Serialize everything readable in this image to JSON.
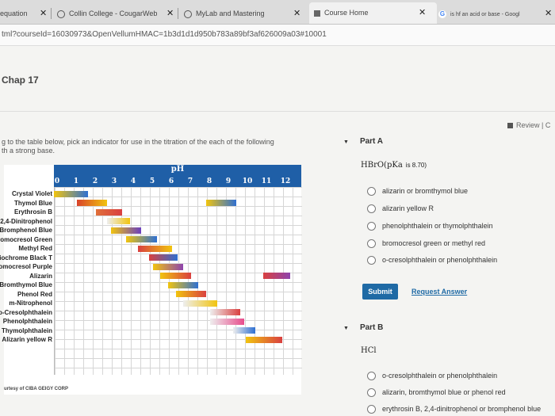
{
  "browser": {
    "tabs": [
      {
        "label": "equation",
        "active": false
      },
      {
        "label": "Collin College - CougarWeb",
        "active": false
      },
      {
        "label": "MyLab and Mastering",
        "active": false
      },
      {
        "label": "Course Home",
        "active": true
      },
      {
        "label": "is hf an acid or base - Googl",
        "active": false
      }
    ],
    "url": "tml?courseId=16030973&OpenVellumHMAC=1b3d1d1d950b783a89bf3af626009a03#10001"
  },
  "page": {
    "chapter": "Chap 17",
    "review_link": "Review | C",
    "intro_line1": "g to the table below, pick an indicator for use in the titration of the each of the following",
    "intro_line2": "th a strong base."
  },
  "chart_data": {
    "type": "table",
    "title": "pH",
    "ph_ticks": [
      "0",
      "1",
      "2",
      "3",
      "4",
      "5",
      "6",
      "7",
      "8",
      "9",
      "10",
      "11",
      "12"
    ],
    "indicators": [
      {
        "name": "Crystal Violet",
        "start": 0,
        "end": 1.8,
        "colors": [
          "#f1c40f",
          "#2e6fd1"
        ]
      },
      {
        "name": "Thymol Blue",
        "start": 1.2,
        "end": 2.8,
        "colors": [
          "#d9432b",
          "#f1c40f"
        ],
        "second": {
          "start": 8.0,
          "end": 9.6,
          "colors": [
            "#f1c40f",
            "#2e6fd1"
          ]
        }
      },
      {
        "name": "Erythrosin B",
        "start": 2.2,
        "end": 3.6,
        "colors": [
          "#e0703a",
          "#d94040"
        ]
      },
      {
        "name": "2,4-Dinitrophenol",
        "start": 2.8,
        "end": 4.0,
        "colors": [
          "#eeeeee",
          "#f1c40f"
        ]
      },
      {
        "name": "Bromphenol Blue",
        "start": 3.0,
        "end": 4.6,
        "colors": [
          "#f1c40f",
          "#6a3fbf"
        ]
      },
      {
        "name": "Bromocresol Green",
        "start": 3.8,
        "end": 5.4,
        "colors": [
          "#f1c40f",
          "#2e6fd1"
        ]
      },
      {
        "name": "Methyl Red",
        "start": 4.4,
        "end": 6.2,
        "colors": [
          "#d94040",
          "#f1c40f"
        ]
      },
      {
        "name": "Eriochrome Black T",
        "start": 5.0,
        "end": 6.5,
        "colors": [
          "#d94040",
          "#2e6fd1"
        ]
      },
      {
        "name": "Bromocresol Purple",
        "start": 5.2,
        "end": 6.8,
        "colors": [
          "#f1c40f",
          "#8e44ad"
        ]
      },
      {
        "name": "Alizarin",
        "start": 5.6,
        "end": 7.2,
        "colors": [
          "#f1c40f",
          "#d94040"
        ],
        "second": {
          "start": 11.0,
          "end": 12.4,
          "colors": [
            "#d94040",
            "#8e44ad"
          ]
        }
      },
      {
        "name": "Bromthymol Blue",
        "start": 6.0,
        "end": 7.6,
        "colors": [
          "#f1c40f",
          "#2e6fd1"
        ]
      },
      {
        "name": "Phenol Red",
        "start": 6.4,
        "end": 8.0,
        "colors": [
          "#f1c40f",
          "#d94040"
        ]
      },
      {
        "name": "m-Nitrophenol",
        "start": 6.8,
        "end": 8.6,
        "colors": [
          "#eeeeee",
          "#f1c40f"
        ]
      },
      {
        "name": "o-Cresolphthalein",
        "start": 8.2,
        "end": 9.8,
        "colors": [
          "#eeeeee",
          "#d94040"
        ]
      },
      {
        "name": "Phenolphthalein",
        "start": 8.2,
        "end": 10.0,
        "colors": [
          "#eeeeee",
          "#e74c8c"
        ]
      },
      {
        "name": "Thymolphthalein",
        "start": 9.4,
        "end": 10.6,
        "colors": [
          "#eeeeee",
          "#2e6fd1"
        ]
      },
      {
        "name": "Alizarin yellow R",
        "start": 10.1,
        "end": 12.0,
        "colors": [
          "#f1c40f",
          "#d94040"
        ]
      }
    ],
    "credit": "urtesy of CIBA GEIGY CORP"
  },
  "partA": {
    "label": "Part A",
    "formula": "HBrO(pKa",
    "formula_note": "is 8.70)",
    "options": [
      "alizarin or bromthymol blue",
      "alizarin yellow R",
      "phenolphthalein or thymolphthalein",
      "bromocresol green or methyl red",
      "o-cresolphthalein or phenolphthalein"
    ],
    "submit": "Submit",
    "request": "Request Answer"
  },
  "partB": {
    "label": "Part B",
    "formula": "HCl",
    "options": [
      "o-cresolphthalein or phenolphthalein",
      "alizarin, bromthymol blue or phenol red",
      "erythrosin B, 2,4-dinitrophenol or bromphenol blue"
    ]
  }
}
